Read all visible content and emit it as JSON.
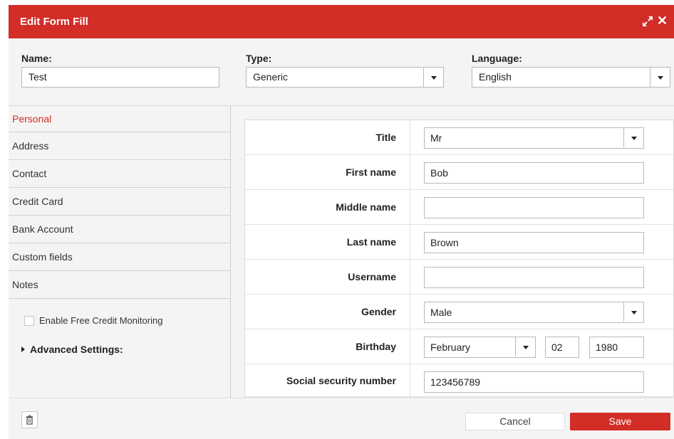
{
  "window": {
    "title": "Edit Form Fill",
    "expand_icon": "expand-icon",
    "close_glyph": "✕",
    "accent_color": "#d32d27"
  },
  "header": {
    "name_label": "Name:",
    "name_value": "Test",
    "type_label": "Type:",
    "type_value": "Generic",
    "language_label": "Language:",
    "language_value": "English"
  },
  "sidebar": {
    "items": [
      {
        "label": "Personal",
        "active": true
      },
      {
        "label": "Address"
      },
      {
        "label": "Contact"
      },
      {
        "label": "Credit Card"
      },
      {
        "label": "Bank Account"
      },
      {
        "label": "Custom fields"
      },
      {
        "label": "Notes"
      }
    ],
    "credit_monitoring_label": "Enable Free Credit Monitoring",
    "credit_monitoring_checked": false,
    "advanced_label": "Advanced Settings:"
  },
  "form": {
    "title_label": "Title",
    "title_value": "Mr",
    "first_name_label": "First name",
    "first_name_value": "Bob",
    "middle_name_label": "Middle name",
    "middle_name_value": "",
    "last_name_label": "Last name",
    "last_name_value": "Brown",
    "username_label": "Username",
    "username_value": "",
    "gender_label": "Gender",
    "gender_value": "Male",
    "birthday_label": "Birthday",
    "birthday_month": "February",
    "birthday_day": "02",
    "birthday_year": "1980",
    "ssn_label": "Social security number",
    "ssn_value": "123456789"
  },
  "footer": {
    "delete_icon": "trash-icon",
    "cancel_label": "Cancel",
    "save_label": "Save"
  }
}
